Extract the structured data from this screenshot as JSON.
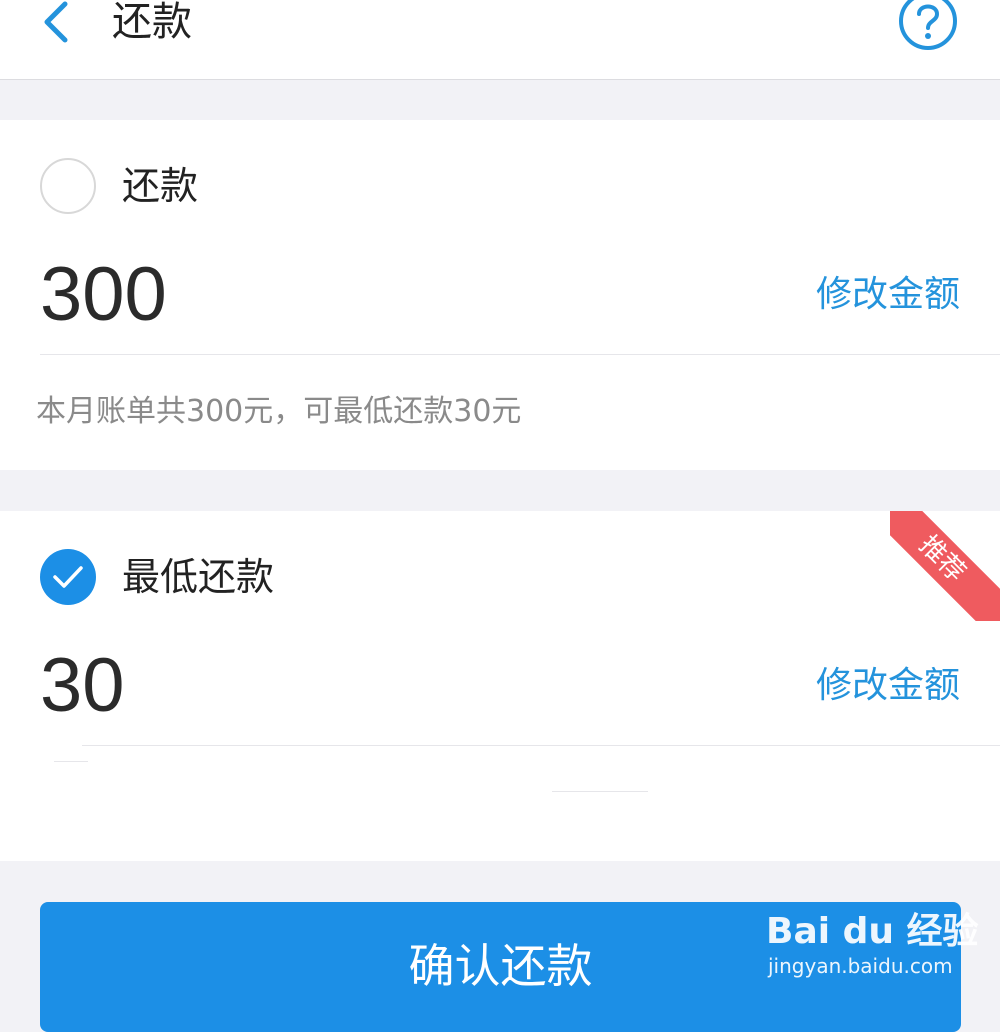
{
  "header": {
    "title": "还款",
    "back_icon": "chevron-left-icon",
    "help_icon": "question-circle-icon"
  },
  "options": [
    {
      "label": "还款",
      "amount": "300",
      "modify_label": "修改金额",
      "note": "本月账单共300元，可最低还款30元",
      "selected": false
    },
    {
      "label": "最低还款",
      "amount": "30",
      "modify_label": "修改金额",
      "badge": "推荐",
      "selected": true
    }
  ],
  "confirm_label": "确认还款",
  "watermark": {
    "brand": "Bai du 经验",
    "url": "jingyan.baidu.com"
  },
  "colors": {
    "accent": "#1c8fe6",
    "link": "#2493dc",
    "badge": "#ef5b5f",
    "background": "#f2f2f6"
  }
}
